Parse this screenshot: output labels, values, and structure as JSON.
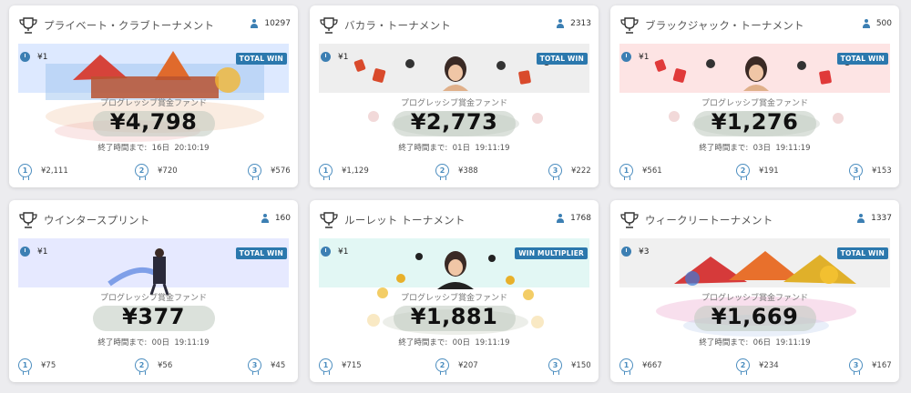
{
  "cards": [
    {
      "title": "プライベート・クラブトーナメント",
      "players": "10297",
      "bet": "¥1",
      "badge": "TOTAL WIN",
      "fund_label": "プログレッシブ賞金ファンド",
      "fund_value": "¥4,798",
      "ends": "終了時間まで:  16日  20:10:19",
      "prizes": [
        "¥2,111",
        "¥720",
        "¥576"
      ],
      "banner_color": "#dde9ff",
      "art": "castle"
    },
    {
      "title": "バカラ・トーナメント",
      "players": "2313",
      "bet": "¥1",
      "badge": "TOTAL WIN",
      "fund_label": "プログレッシブ賞金ファンド",
      "fund_value": "¥2,773",
      "ends": "終了時間まで:  01日  19:11:19",
      "prizes": [
        "¥1,129",
        "¥388",
        "¥222"
      ],
      "banner_color": "#eeeeee",
      "art": "dealer-cards"
    },
    {
      "title": "ブラックジャック・トーナメント",
      "players": "500",
      "bet": "¥1",
      "badge": "TOTAL WIN",
      "fund_label": "プログレッシブ賞金ファンド",
      "fund_value": "¥1,276",
      "ends": "終了時間まで:  03日  19:11:19",
      "prizes": [
        "¥561",
        "¥191",
        "¥153"
      ],
      "banner_color": "#fde4e4",
      "art": "dealer-cards"
    },
    {
      "title": "ウインタースプリント",
      "players": "160",
      "bet": "¥1",
      "badge": "TOTAL WIN",
      "fund_label": "プログレッシブ賞金ファンド",
      "fund_value": "¥377",
      "ends": "終了時間まで:  00日  19:11:19",
      "prizes": [
        "¥75",
        "¥56",
        "¥45"
      ],
      "banner_color": "#e6e9ff",
      "art": "athlete"
    },
    {
      "title": "ルーレット トーナメント",
      "players": "1768",
      "bet": "¥1",
      "badge": "WIN MULTIPLIER",
      "fund_label": "プログレッシブ賞金ファンド",
      "fund_value": "¥1,881",
      "ends": "終了時間まで:  00日  19:11:19",
      "prizes": [
        "¥715",
        "¥207",
        "¥150"
      ],
      "banner_color": "#e2f7f4",
      "art": "dealer-coins"
    },
    {
      "title": "ウィークリートーナメント",
      "players": "1337",
      "bet": "¥3",
      "badge": "TOTAL WIN",
      "fund_label": "プログレッシブ賞金ファンド",
      "fund_value": "¥1,669",
      "ends": "終了時間まで:  06日  19:11:19",
      "prizes": [
        "¥667",
        "¥234",
        "¥167"
      ],
      "banner_color": "#f0f0f0",
      "art": "dragons"
    }
  ],
  "icons": {
    "title": "trophy-icon",
    "players": "user-icon",
    "bet": "clock-icon",
    "prize": "medal-icon"
  },
  "colors": {
    "accent": "#2b78ad",
    "medal": "#4b8dbf"
  }
}
